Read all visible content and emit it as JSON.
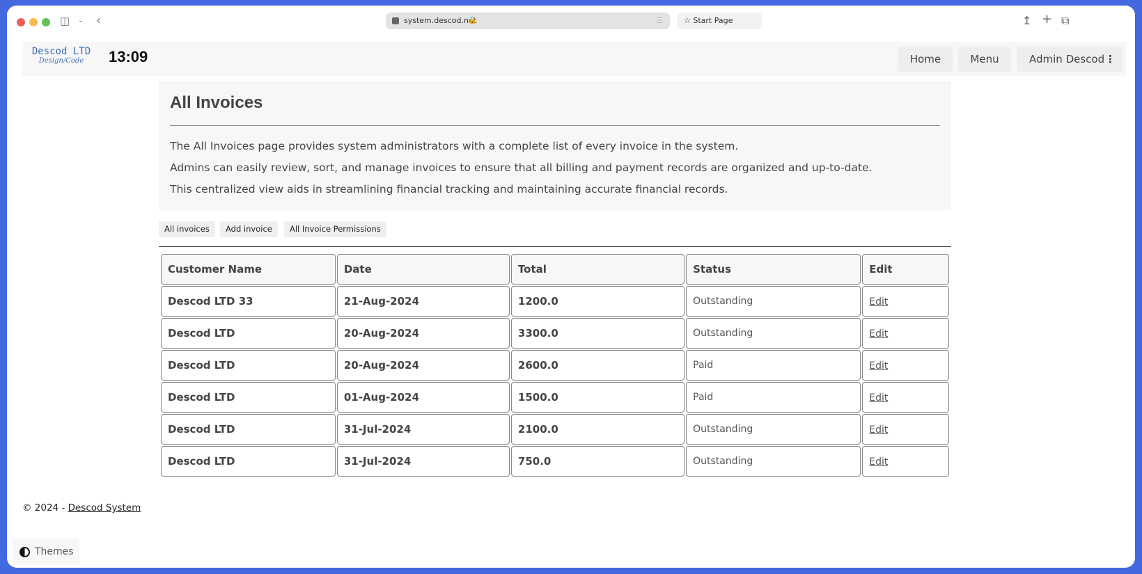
{
  "browser": {
    "url": "system.descod.net",
    "start_page_label": "Start Page"
  },
  "navbar": {
    "logo_main": "Descod LTD",
    "logo_sub": "Design/Code",
    "clock": "13:09",
    "home_label": "Home",
    "menu_label": "Menu",
    "user_label": "Admin Descod"
  },
  "intro": {
    "title": "All Invoices",
    "paragraphs": [
      "The All Invoices page provides system administrators with a complete list of every invoice in the system.",
      "Admins can easily review, sort, and manage invoices to ensure that all billing and payment records are organized and up-to-date.",
      "This centralized view aids in streamlining financial tracking and maintaining accurate financial records."
    ]
  },
  "subnav": {
    "all_invoices": "All invoices",
    "add_invoice": "Add invoice",
    "permissions": "All Invoice Permissions"
  },
  "table": {
    "headers": [
      "Customer Name",
      "Date",
      "Total",
      "Status",
      "Edit"
    ],
    "rows": [
      {
        "customer": "Descod LTD 33",
        "date": "21-Aug-2024",
        "total": "1200.0",
        "status": "Outstanding",
        "edit": "Edit"
      },
      {
        "customer": "Descod LTD",
        "date": "20-Aug-2024",
        "total": "3300.0",
        "status": "Outstanding",
        "edit": "Edit"
      },
      {
        "customer": "Descod LTD",
        "date": "20-Aug-2024",
        "total": "2600.0",
        "status": "Paid",
        "edit": "Edit"
      },
      {
        "customer": "Descod LTD",
        "date": "01-Aug-2024",
        "total": "1500.0",
        "status": "Paid",
        "edit": "Edit"
      },
      {
        "customer": "Descod LTD",
        "date": "31-Jul-2024",
        "total": "2100.0",
        "status": "Outstanding",
        "edit": "Edit"
      },
      {
        "customer": "Descod LTD",
        "date": "31-Jul-2024",
        "total": "750.0",
        "status": "Outstanding",
        "edit": "Edit"
      }
    ]
  },
  "footer": {
    "copyright": "© 2024 - ",
    "link": "Descod System"
  },
  "themes_label": "Themes",
  "colors": {
    "frame": "#4368e0",
    "logo": "#3a6db0"
  }
}
